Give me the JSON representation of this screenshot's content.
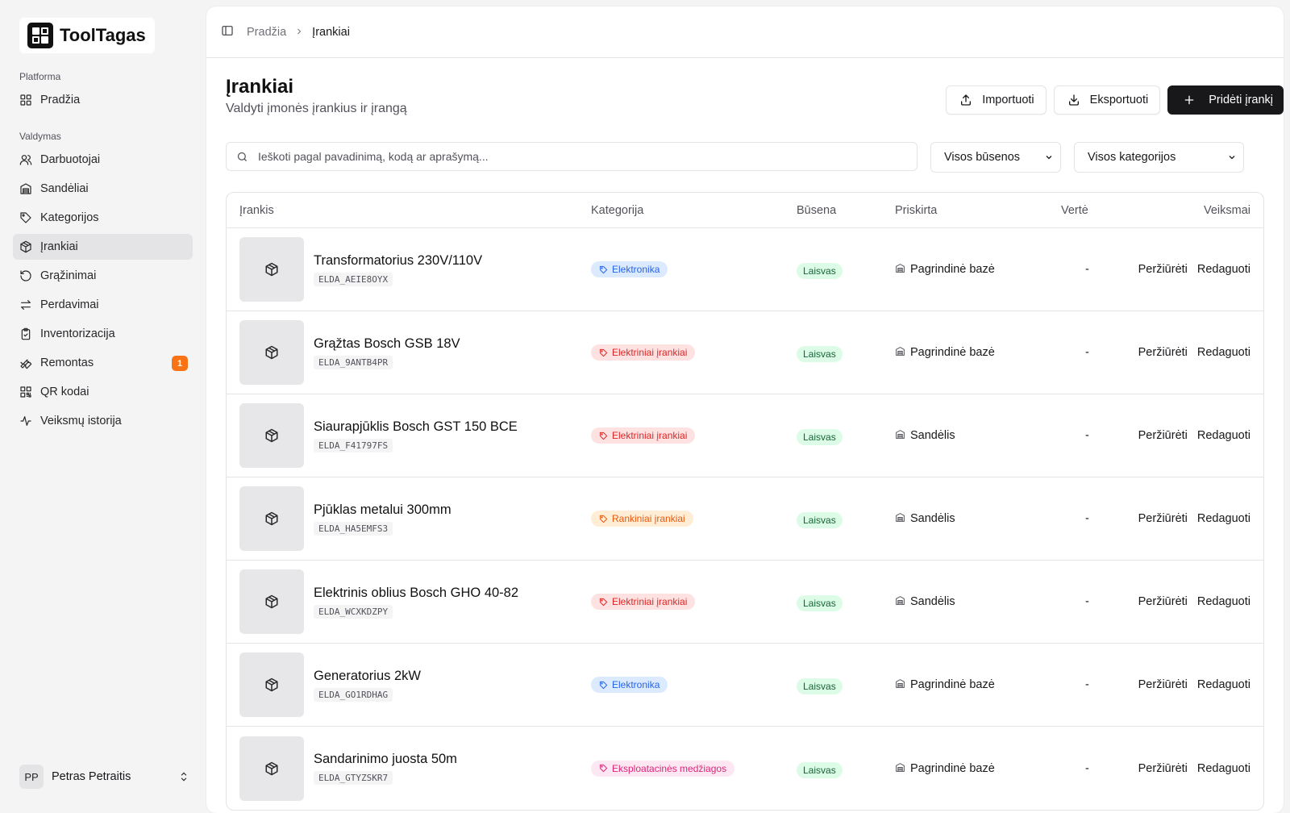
{
  "app": {
    "name": "ToolTagas"
  },
  "sidebar": {
    "group_platform": "Platforma",
    "group_manage": "Valdymas",
    "home": "Pradžia",
    "items": [
      {
        "label": "Darbuotojai",
        "icon": "users-icon"
      },
      {
        "label": "Sandėliai",
        "icon": "warehouse-icon"
      },
      {
        "label": "Kategorijos",
        "icon": "tag-icon"
      },
      {
        "label": "Įrankiai",
        "icon": "package-icon",
        "active": true
      },
      {
        "label": "Grąžinimai",
        "icon": "undo-icon"
      },
      {
        "label": "Perdavimai",
        "icon": "transfer-icon"
      },
      {
        "label": "Inventorizacija",
        "icon": "clipboard-icon"
      },
      {
        "label": "Remontas",
        "icon": "wrench-icon",
        "badge": "1"
      },
      {
        "label": "QR kodai",
        "icon": "qr-icon"
      },
      {
        "label": "Veiksmų istorija",
        "icon": "activity-icon"
      }
    ],
    "user": {
      "initials": "PP",
      "name": "Petras Petraitis"
    }
  },
  "breadcrumb": {
    "home": "Pradžia",
    "current": "Įrankiai"
  },
  "page": {
    "title": "Įrankiai",
    "subtitle": "Valdyti įmonės įrankius ir įrangą",
    "import_label": "Importuoti",
    "export_label": "Eksportuoti",
    "add_label": "Pridėti įrankį"
  },
  "filters": {
    "search_placeholder": "Ieškoti pagal pavadinimą, kodą ar aprašymą...",
    "status_value": "Visos būsenos",
    "category_value": "Visos kategorijos"
  },
  "table": {
    "headers": {
      "tool": "Įrankis",
      "category": "Kategorija",
      "status": "Būsena",
      "assigned": "Priskirta",
      "value": "Vertė",
      "actions": "Veiksmai"
    },
    "view_label": "Peržiūrėti",
    "edit_label": "Redaguoti",
    "rows": [
      {
        "name": "Transformatorius 230V/110V",
        "code": "ELDA_AEIE8OYX",
        "category": "Elektronika",
        "cat_color": "#2563eb",
        "cat_bg": "#dbeafe",
        "status": "Laisvas",
        "assigned": "Pagrindinė bazė",
        "value": "-"
      },
      {
        "name": "Grąžtas Bosch GSB 18V",
        "code": "ELDA_9ANTB4PR",
        "category": "Elektriniai įrankiai",
        "cat_color": "#dc2626",
        "cat_bg": "#fee2e2",
        "status": "Laisvas",
        "assigned": "Pagrindinė bazė",
        "value": "-"
      },
      {
        "name": "Siaurapjūklis Bosch GST 150 BCE",
        "code": "ELDA_F41797FS",
        "category": "Elektriniai įrankiai",
        "cat_color": "#dc2626",
        "cat_bg": "#fee2e2",
        "status": "Laisvas",
        "assigned": "Sandėlis",
        "value": "-"
      },
      {
        "name": "Pjūklas metalui 300mm",
        "code": "ELDA_HA5EMFS3",
        "category": "Rankiniai įrankiai",
        "cat_color": "#ea580c",
        "cat_bg": "#ffedd5",
        "status": "Laisvas",
        "assigned": "Sandėlis",
        "value": "-"
      },
      {
        "name": "Elektrinis oblius Bosch GHO 40-82",
        "code": "ELDA_WCXKDZPY",
        "category": "Elektriniai įrankiai",
        "cat_color": "#dc2626",
        "cat_bg": "#fee2e2",
        "status": "Laisvas",
        "assigned": "Sandėlis",
        "value": "-"
      },
      {
        "name": "Generatorius 2kW",
        "code": "ELDA_GO1RDHAG",
        "category": "Elektronika",
        "cat_color": "#2563eb",
        "cat_bg": "#dbeafe",
        "status": "Laisvas",
        "assigned": "Pagrindinė bazė",
        "value": "-"
      },
      {
        "name": "Sandarinimo juosta 50m",
        "code": "ELDA_GTYZSKR7",
        "category": "Eksploatacinės medžiagos",
        "cat_color": "#db2777",
        "cat_bg": "#fce7f3",
        "status": "Laisvas",
        "assigned": "Pagrindinė bazė",
        "value": "-"
      }
    ]
  }
}
